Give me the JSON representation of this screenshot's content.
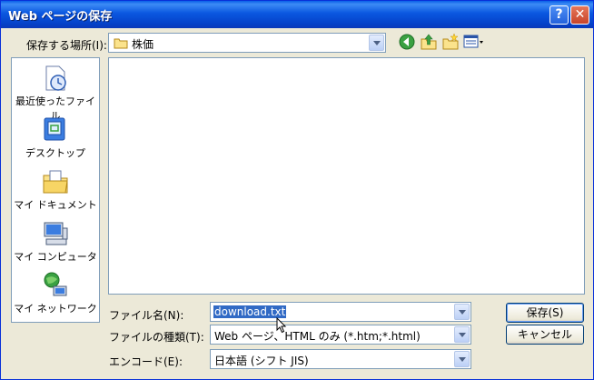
{
  "window": {
    "title": "Web ページの保存",
    "help_label": "?",
    "close_label": "✕"
  },
  "location": {
    "label": "保存する場所(I):",
    "value": "株価",
    "icon": "folder-icon"
  },
  "toolbar": {
    "icons": [
      "back-icon",
      "up-folder-icon",
      "new-folder-icon",
      "view-menu-icon"
    ]
  },
  "places": [
    {
      "label": "最近使ったファイル",
      "icon": "recent-documents-icon"
    },
    {
      "label": "デスクトップ",
      "icon": "desktop-icon"
    },
    {
      "label": "マイ ドキュメント",
      "icon": "my-documents-icon"
    },
    {
      "label": "マイ コンピュータ",
      "icon": "my-computer-icon"
    },
    {
      "label": "マイ ネットワーク",
      "icon": "my-network-icon"
    }
  ],
  "fields": {
    "filename": {
      "label": "ファイル名(N):",
      "value": "download.txt"
    },
    "filetype": {
      "label": "ファイルの種類(T):",
      "value": "Web ページ、HTML のみ (*.htm;*.html)"
    },
    "encoding": {
      "label": "エンコード(E):",
      "value": "日本語 (シフト JIS)"
    }
  },
  "buttons": {
    "save": "保存(S)",
    "cancel": "キャンセル"
  }
}
